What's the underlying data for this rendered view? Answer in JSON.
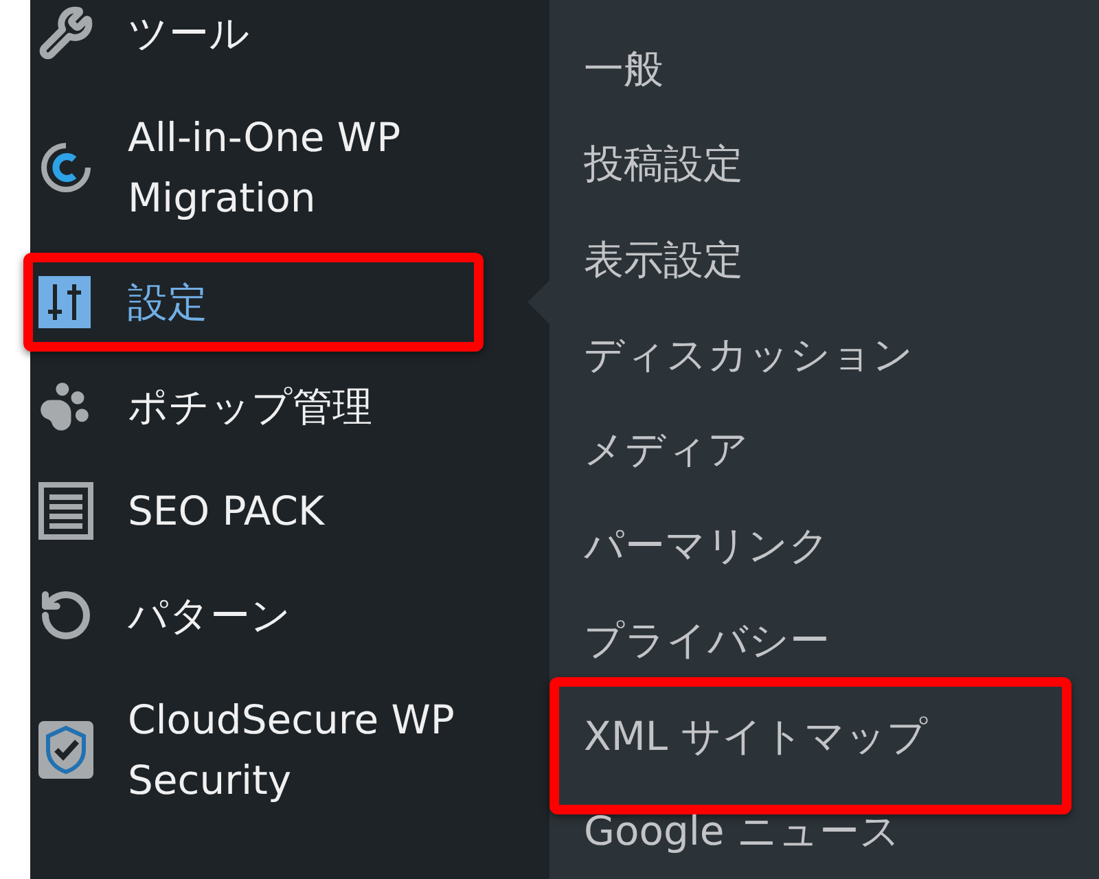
{
  "menu": {
    "items": [
      {
        "label": "ツール",
        "kind": "wrench",
        "selected": false,
        "highlighted": false
      },
      {
        "label": "All-in-One WP Migration",
        "kind": "migration",
        "selected": false,
        "highlighted": false
      },
      {
        "label": "設定",
        "kind": "sliders",
        "selected": true,
        "highlighted": true
      },
      {
        "label": "ポチップ管理",
        "kind": "paw",
        "selected": false,
        "highlighted": false
      },
      {
        "label": "SEO PACK",
        "kind": "list",
        "selected": false,
        "highlighted": false
      },
      {
        "label": "パターン",
        "kind": "undo",
        "selected": false,
        "highlighted": false
      },
      {
        "label": "CloudSecure WP Security",
        "kind": "shield",
        "selected": false,
        "highlighted": false
      }
    ]
  },
  "submenu": {
    "items": [
      {
        "label": "一般",
        "highlighted": false
      },
      {
        "label": "投稿設定",
        "highlighted": false
      },
      {
        "label": "表示設定",
        "highlighted": false
      },
      {
        "label": "ディスカッション",
        "highlighted": false
      },
      {
        "label": "メディア",
        "highlighted": false
      },
      {
        "label": "パーマリンク",
        "highlighted": false
      },
      {
        "label": "プライバシー",
        "highlighted": false
      },
      {
        "label": "XML サイトマップ",
        "highlighted": true
      },
      {
        "label": "Google ニュース",
        "highlighted": false
      }
    ]
  }
}
